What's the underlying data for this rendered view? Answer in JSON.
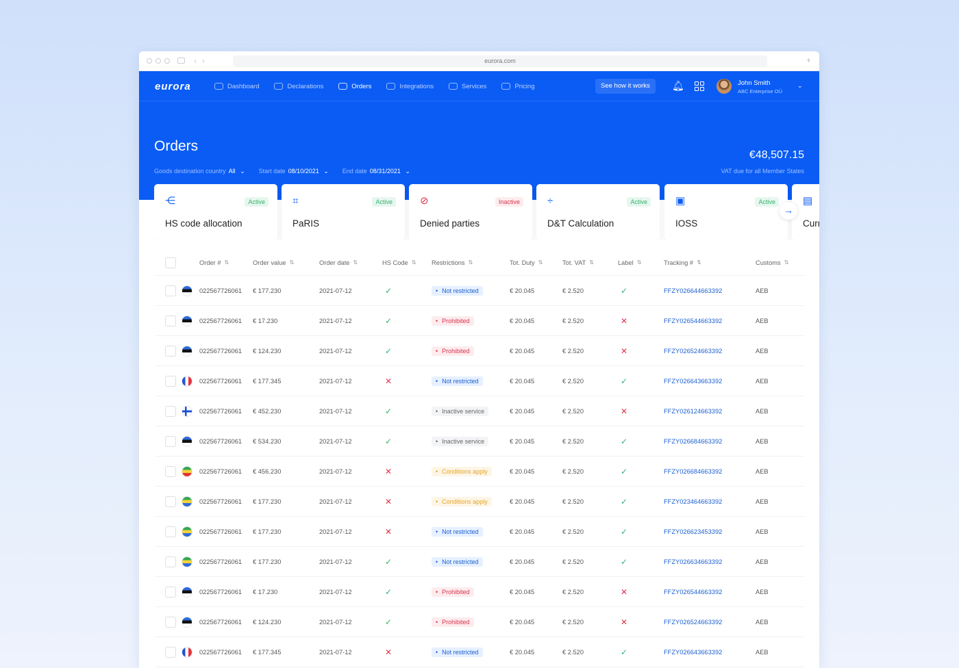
{
  "browser": {
    "url": "eurora.com"
  },
  "brand": {
    "logo": "eurora",
    "primary": "#0a5cf5"
  },
  "nav": [
    {
      "label": "Dashboard",
      "icon": "chart-line-icon",
      "active": false
    },
    {
      "label": "Declarations",
      "icon": "document-icon",
      "active": false
    },
    {
      "label": "Orders",
      "icon": "orders-icon",
      "active": true
    },
    {
      "label": "Integrations",
      "icon": "integrations-icon",
      "active": false
    },
    {
      "label": "Services",
      "icon": "services-icon",
      "active": false
    },
    {
      "label": "Pricing",
      "icon": "pricing-icon",
      "active": false
    }
  ],
  "header": {
    "cta": "See how it works",
    "user_name": "John Smith",
    "user_org": "ABC Enterprise OÜ"
  },
  "page": {
    "title": "Orders",
    "filters": {
      "country_label": "Goods destination country",
      "country_value": "All",
      "start_label": "Start date",
      "start_value": "08/10/2021",
      "end_label": "End date",
      "end_value": "08/31/2021"
    },
    "vat_amount": "€48,507.15",
    "vat_label": "VAT due for all Member States"
  },
  "services": [
    {
      "name": "HS code allocation",
      "status": "Active",
      "icon": "share-icon"
    },
    {
      "name": "PaRIS",
      "status": "Active",
      "icon": "qr-scan-icon"
    },
    {
      "name": "Denied parties",
      "status": "Inactive",
      "icon": "prohibited-icon"
    },
    {
      "name": "D&T Calculation",
      "status": "Active",
      "icon": "divide-icon"
    },
    {
      "name": "IOSS",
      "status": "Active",
      "icon": "wallet-icon"
    },
    {
      "name": "Curr",
      "status": "",
      "icon": "currency-icon"
    }
  ],
  "table": {
    "columns": [
      "Order #",
      "Order value",
      "Order date",
      "HS Code",
      "Restrictions",
      "Tot. Duty",
      "Tot. VAT",
      "Label",
      "Tracking #",
      "Customs"
    ],
    "rows": [
      {
        "flag": "ee",
        "order": "022567726061",
        "value": "€ 177.230",
        "date": "2021-07-12",
        "hs": true,
        "restriction": "Not restricted",
        "rtype": "blue",
        "duty": "€ 20.045",
        "vat": "€ 2.520",
        "label": true,
        "tracking": "FFZY026644663392",
        "customs": "AEB"
      },
      {
        "flag": "ee",
        "order": "022567726061",
        "value": "€ 17.230",
        "date": "2021-07-12",
        "hs": true,
        "restriction": "Prohibited",
        "rtype": "red",
        "duty": "€ 20.045",
        "vat": "€ 2.520",
        "label": false,
        "tracking": "FFZY026544663392",
        "customs": "AEB"
      },
      {
        "flag": "ee",
        "order": "022567726061",
        "value": "€ 124.230",
        "date": "2021-07-12",
        "hs": true,
        "restriction": "Prohibited",
        "rtype": "red",
        "duty": "€ 20.045",
        "vat": "€ 2.520",
        "label": false,
        "tracking": "FFZY026524663392",
        "customs": "AEB"
      },
      {
        "flag": "fr",
        "order": "022567726061",
        "value": "€ 177.345",
        "date": "2021-07-12",
        "hs": false,
        "restriction": "Not restricted",
        "rtype": "blue",
        "duty": "€ 20.045",
        "vat": "€ 2.520",
        "label": true,
        "tracking": "FFZY026643663392",
        "customs": "AEB"
      },
      {
        "flag": "fi",
        "order": "022567726061",
        "value": "€ 452.230",
        "date": "2021-07-12",
        "hs": true,
        "restriction": "Inactive service",
        "rtype": "grey",
        "duty": "€ 20.045",
        "vat": "€ 2.520",
        "label": false,
        "tracking": "FFZY026124663392",
        "customs": "AEB"
      },
      {
        "flag": "ee",
        "order": "022567726061",
        "value": "€ 534.230",
        "date": "2021-07-12",
        "hs": true,
        "restriction": "Inactive service",
        "rtype": "grey",
        "duty": "€ 20.045",
        "vat": "€ 2.520",
        "label": true,
        "tracking": "FFZY026684663392",
        "customs": "AEB"
      },
      {
        "flag": "et",
        "order": "022567726061",
        "value": "€ 456.230",
        "date": "2021-07-12",
        "hs": false,
        "restriction": "Conditions apply",
        "rtype": "yellow",
        "duty": "€ 20.045",
        "vat": "€ 2.520",
        "label": true,
        "tracking": "FFZY026684663392",
        "customs": "AEB"
      },
      {
        "flag": "ga",
        "order": "022567726061",
        "value": "€ 177.230",
        "date": "2021-07-12",
        "hs": false,
        "restriction": "Conditions apply",
        "rtype": "yellow",
        "duty": "€ 20.045",
        "vat": "€ 2.520",
        "label": true,
        "tracking": "FFZY023464663392",
        "customs": "AEB"
      },
      {
        "flag": "ga",
        "order": "022567726061",
        "value": "€ 177.230",
        "date": "2021-07-12",
        "hs": false,
        "restriction": "Not restricted",
        "rtype": "blue",
        "duty": "€ 20.045",
        "vat": "€ 2.520",
        "label": true,
        "tracking": "FFZY026623453392",
        "customs": "AEB"
      },
      {
        "flag": "ga",
        "order": "022567726061",
        "value": "€ 177.230",
        "date": "2021-07-12",
        "hs": true,
        "restriction": "Not restricted",
        "rtype": "blue",
        "duty": "€ 20.045",
        "vat": "€ 2.520",
        "label": true,
        "tracking": "FFZY026634663392",
        "customs": "AEB"
      },
      {
        "flag": "ee",
        "order": "022567726061",
        "value": "€ 17.230",
        "date": "2021-07-12",
        "hs": true,
        "restriction": "Prohibited",
        "rtype": "red",
        "duty": "€ 20.045",
        "vat": "€ 2.520",
        "label": false,
        "tracking": "FFZY026544663392",
        "customs": "AEB"
      },
      {
        "flag": "ee",
        "order": "022567726061",
        "value": "€ 124.230",
        "date": "2021-07-12",
        "hs": true,
        "restriction": "Prohibited",
        "rtype": "red",
        "duty": "€ 20.045",
        "vat": "€ 2.520",
        "label": false,
        "tracking": "FFZY026524663392",
        "customs": "AEB"
      },
      {
        "flag": "fr",
        "order": "022567726061",
        "value": "€ 177.345",
        "date": "2021-07-12",
        "hs": false,
        "restriction": "Not restricted",
        "rtype": "blue",
        "duty": "€ 20.045",
        "vat": "€ 2.520",
        "label": true,
        "tracking": "FFZY026643663392",
        "customs": "AEB"
      }
    ]
  }
}
